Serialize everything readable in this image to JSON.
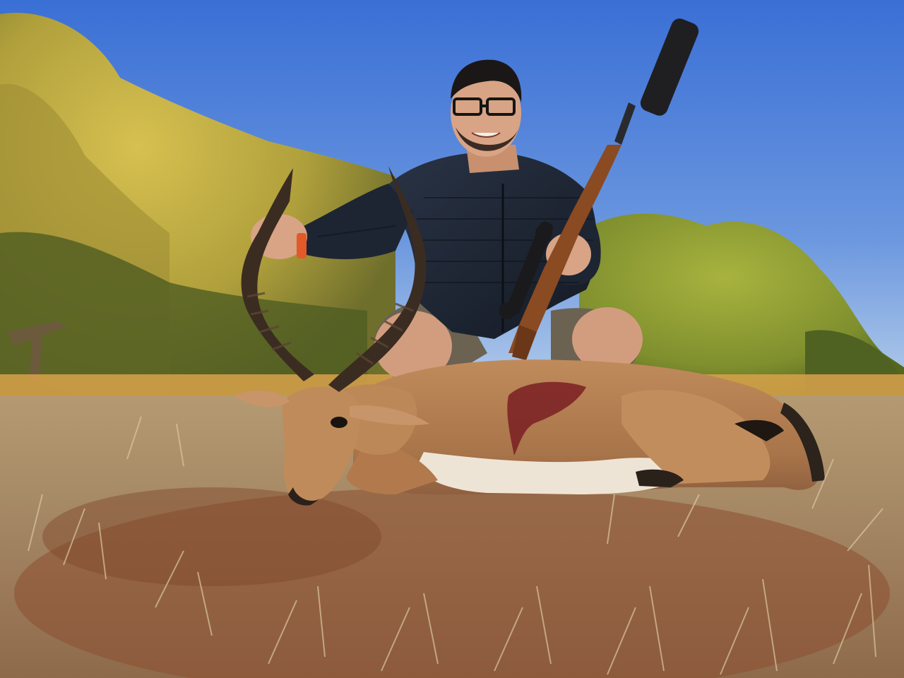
{
  "photo": {
    "alt": "",
    "palette": {
      "sky_top": "#3f73d6",
      "sky_bottom": "#a7c6ea",
      "tree_sunlit": "#c9b84a",
      "tree_shadow": "#5d6a2a",
      "tree_green": "#8fa23a",
      "dry_grass": "#b99b6e",
      "red_soil": "#8a4a2c",
      "impala_coat": "#b88356",
      "impala_belly": "#efe7dc",
      "blood": "#7a1f23",
      "jacket": "#1c2432",
      "shorts": "#6b6252",
      "skin": "#d8a485",
      "rifle_wood": "#8a4a22",
      "rifle_metal": "#1f1f22"
    }
  }
}
